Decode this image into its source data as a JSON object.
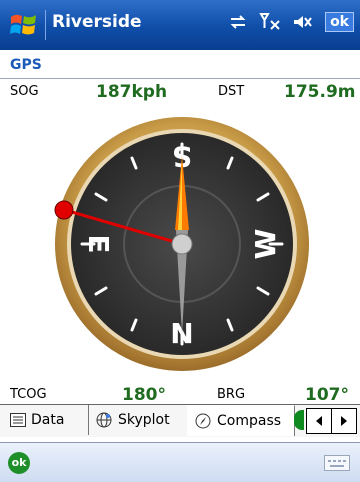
{
  "titlebar": {
    "app_title": "Riverside",
    "icons": [
      "windows-logo-icon",
      "network-icon",
      "signal-icon",
      "volume-muted-icon"
    ],
    "ok_label": "ok"
  },
  "gps": {
    "label": "GPS"
  },
  "stats": {
    "sog_label": "SOG",
    "sog_value": "187kph",
    "dst_label": "DST",
    "dst_value": "175.9m",
    "tcog_label": "TCOG",
    "tcog_value": "180°",
    "brg_label": "BRG",
    "brg_value": "107°"
  },
  "compass": {
    "cardinals": {
      "top": "S",
      "left": "E",
      "right": "W",
      "bottom": "N"
    },
    "colors": {
      "rim": "#c89b47",
      "face": "#333333",
      "needle_orange": "#ff7a00",
      "marker_red": "#e00000"
    }
  },
  "tabs": [
    {
      "label": "Data",
      "icon": "list-icon"
    },
    {
      "label": "Skyplot",
      "icon": "globe-icon"
    },
    {
      "label": "Compass",
      "icon": "compass-icon"
    }
  ],
  "bottombar": {
    "ok_label": "ok",
    "keyboard_icon": "keyboard-icon"
  }
}
